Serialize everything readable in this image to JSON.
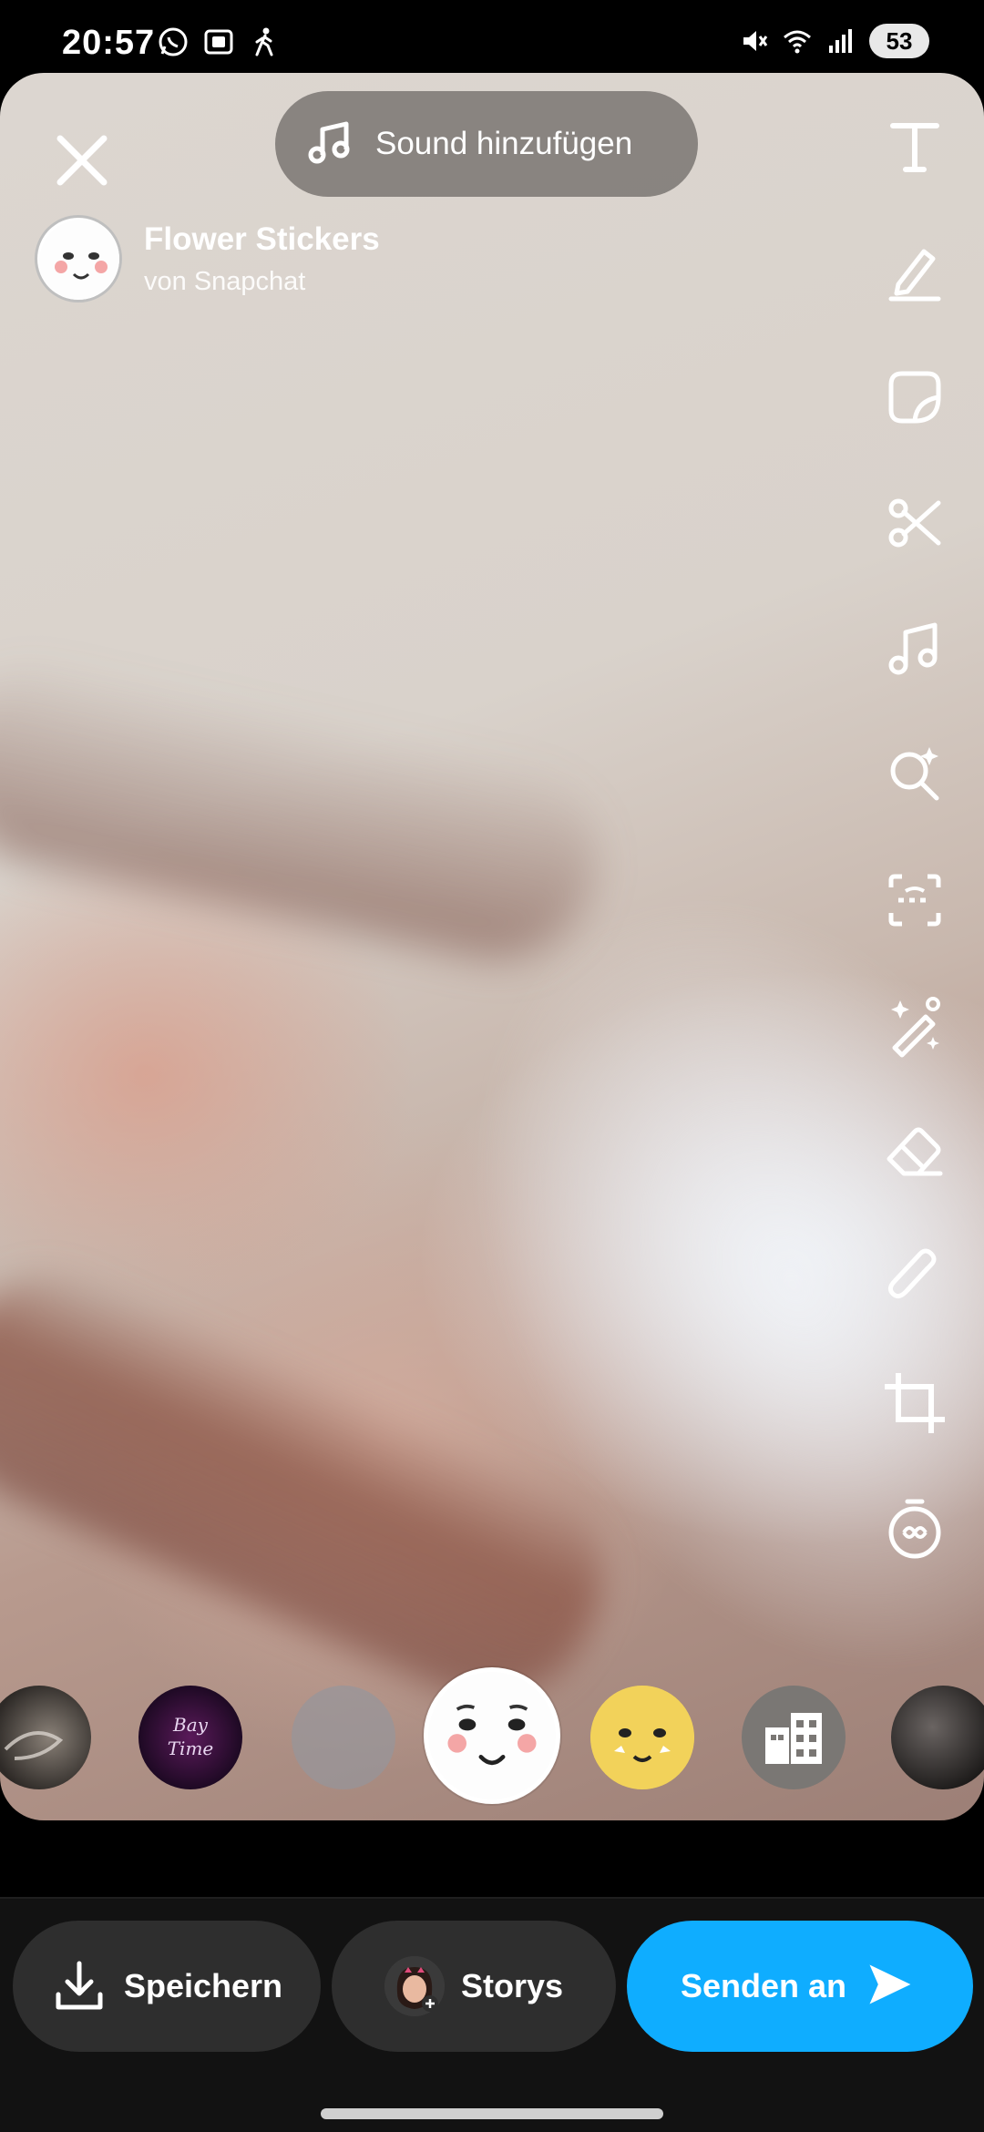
{
  "status_bar": {
    "time": "20:57",
    "battery": "53",
    "left_icons": [
      "whatsapp-icon",
      "screen-record-icon",
      "walking-icon"
    ],
    "right_icons": [
      "mute-icon",
      "wifi-icon",
      "signal-icon"
    ]
  },
  "top": {
    "sound_label": "Sound hinzufügen"
  },
  "lens": {
    "name": "Flower Stickers",
    "creator": "von Snapchat"
  },
  "tools": [
    "text-icon",
    "pen-icon",
    "sticker-icon",
    "scissors-icon",
    "music-icon",
    "lens-search-icon",
    "scan-icon",
    "magic-wand-icon",
    "eraser-icon",
    "paperclip-icon",
    "crop-icon",
    "timer-icon"
  ],
  "carousel": {
    "items": [
      "smoke-lens",
      "purple-lens",
      "blank-lens",
      "flower-stickers-lens",
      "yellow-face-lens",
      "city-lens",
      "photo-lens"
    ],
    "selected": "flower-stickers-lens",
    "item2_text": "Bay Time"
  },
  "bottom_bar": {
    "save_label": "Speichern",
    "story_label": "Storys",
    "send_label": "Senden an"
  },
  "colors": {
    "send_button": "#0fadff",
    "button_bg": "#2e2e2e",
    "bar_bg": "#121212"
  }
}
